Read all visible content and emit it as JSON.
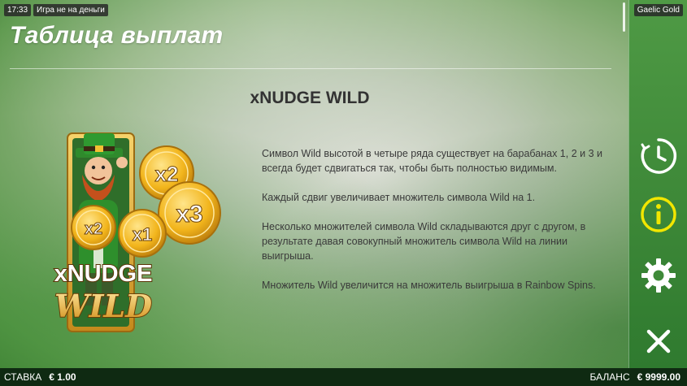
{
  "status": {
    "time": "17:33",
    "mode": "Игра не на деньги",
    "game_name": "Gaelic Gold"
  },
  "page": {
    "title": "Таблица выплат",
    "section_heading": "xNUDGE WILD",
    "paragraphs": [
      "Символ Wild высотой в четыре ряда существует на барабанах 1, 2 и 3 и всегда будет сдвигаться так, чтобы быть полностью видимым.",
      "Каждый сдвиг увеличивает множитель символа Wild на 1.",
      "Несколько множителей символа Wild складываются друг с другом, в результате давая совокупный множитель символа Wild на линии выигрыша.",
      "Множитель Wild увеличится на множитель выигрыша в Rainbow Spins."
    ]
  },
  "symbol": {
    "logo_line1": "xNUDGE",
    "logo_line2": "WILD",
    "coins": [
      "x2",
      "x3",
      "x2",
      "x1"
    ]
  },
  "side_panel": {
    "icons": [
      "history-clock-icon",
      "info-icon",
      "settings-gear-icon",
      "close-icon"
    ]
  },
  "footer": {
    "bet_label": "СТАВКА",
    "bet_value": "€ 1.00",
    "balance_label": "БАЛАНС",
    "balance_value": "€ 9999.00"
  },
  "colors": {
    "side_panel": "#3f8a39",
    "bottom_bar": "#0f2a12",
    "info_accent": "#f2e600",
    "coin_gold": "#f2b51c"
  }
}
